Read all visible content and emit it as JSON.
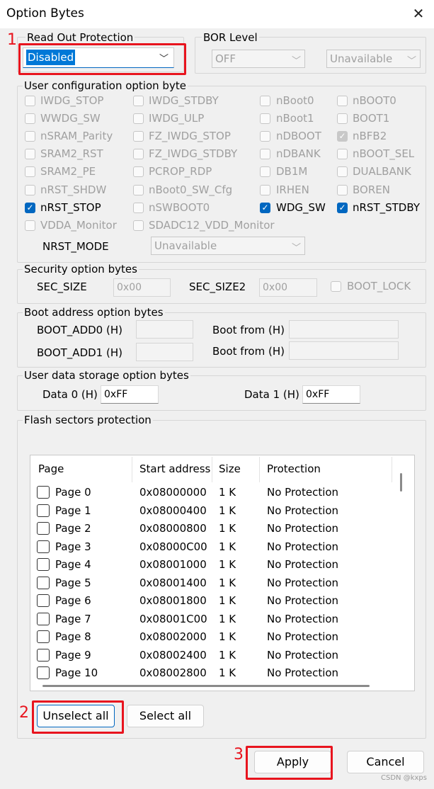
{
  "window": {
    "title": "Option Bytes",
    "close_glyph": "✕"
  },
  "rdp": {
    "legend": "Read Out Protection",
    "value": "Disabled",
    "annotation": "1"
  },
  "bor": {
    "legend": "BOR Level",
    "level_value": "OFF",
    "second_value": "Unavailable"
  },
  "user_config": {
    "legend": "User configuration option byte",
    "options": [
      {
        "label": "IWDG_STOP",
        "checked": false,
        "enabled": false
      },
      {
        "label": "IWDG_STDBY",
        "checked": false,
        "enabled": false
      },
      {
        "label": "nBoot0",
        "checked": false,
        "enabled": false
      },
      {
        "label": "nBOOT0",
        "checked": false,
        "enabled": false
      },
      {
        "label": "WWDG_SW",
        "checked": false,
        "enabled": false
      },
      {
        "label": "IWDG_ULP",
        "checked": false,
        "enabled": false
      },
      {
        "label": "nBoot1",
        "checked": false,
        "enabled": false
      },
      {
        "label": "BOOT1",
        "checked": false,
        "enabled": false
      },
      {
        "label": "nSRAM_Parity",
        "checked": false,
        "enabled": false
      },
      {
        "label": "FZ_IWDG_STOP",
        "checked": false,
        "enabled": false
      },
      {
        "label": "nDBOOT",
        "checked": false,
        "enabled": false
      },
      {
        "label": "nBFB2",
        "checked": true,
        "enabled": false
      },
      {
        "label": "SRAM2_RST",
        "checked": false,
        "enabled": false
      },
      {
        "label": "FZ_IWDG_STDBY",
        "checked": false,
        "enabled": false
      },
      {
        "label": "nDBANK",
        "checked": false,
        "enabled": false
      },
      {
        "label": "nBOOT_SEL",
        "checked": false,
        "enabled": false
      },
      {
        "label": "SRAM2_PE",
        "checked": false,
        "enabled": false
      },
      {
        "label": "PCROP_RDP",
        "checked": false,
        "enabled": false
      },
      {
        "label": "DB1M",
        "checked": false,
        "enabled": false
      },
      {
        "label": "DUALBANK",
        "checked": false,
        "enabled": false
      },
      {
        "label": "nRST_SHDW",
        "checked": false,
        "enabled": false
      },
      {
        "label": "nBoot0_SW_Cfg",
        "checked": false,
        "enabled": false
      },
      {
        "label": "IRHEN",
        "checked": false,
        "enabled": false
      },
      {
        "label": "BOREN",
        "checked": false,
        "enabled": false
      },
      {
        "label": "nRST_STOP",
        "checked": true,
        "enabled": true
      },
      {
        "label": "nSWBOOT0",
        "checked": false,
        "enabled": false
      },
      {
        "label": "WDG_SW",
        "checked": true,
        "enabled": true
      },
      {
        "label": "nRST_STDBY",
        "checked": true,
        "enabled": true
      },
      {
        "label": "VDDA_Monitor",
        "checked": false,
        "enabled": false
      },
      {
        "label": "SDADC12_VDD_Monitor",
        "checked": false,
        "enabled": false
      }
    ],
    "nrst_mode_label": "NRST_MODE",
    "nrst_mode_value": "Unavailable"
  },
  "security": {
    "legend": "Security option bytes",
    "sec_size_label": "SEC_SIZE",
    "sec_size_value": "0x00",
    "sec_size2_label": "SEC_SIZE2",
    "sec_size2_value": "0x00",
    "boot_lock_label": "BOOT_LOCK"
  },
  "boot_addr": {
    "legend": "Boot address option bytes",
    "add0_label": "BOOT_ADD0 (H)",
    "add1_label": "BOOT_ADD1 (H)",
    "from0_label": "Boot from (H)",
    "from1_label": "Boot from (H)"
  },
  "user_data": {
    "legend": "User data storage option bytes",
    "data0_label": "Data 0 (H)",
    "data0_value": "0xFF",
    "data1_label": "Data 1 (H)",
    "data1_value": "0xFF"
  },
  "flash": {
    "legend": "Flash sectors protection",
    "columns": [
      "Page",
      "Start address",
      "Size",
      "Protection"
    ],
    "rows": [
      [
        "Page 0",
        "0x08000000",
        "1 K",
        "No Protection"
      ],
      [
        "Page 1",
        "0x08000400",
        "1 K",
        "No Protection"
      ],
      [
        "Page 2",
        "0x08000800",
        "1 K",
        "No Protection"
      ],
      [
        "Page 3",
        "0x08000C00",
        "1 K",
        "No Protection"
      ],
      [
        "Page 4",
        "0x08001000",
        "1 K",
        "No Protection"
      ],
      [
        "Page 5",
        "0x08001400",
        "1 K",
        "No Protection"
      ],
      [
        "Page 6",
        "0x08001800",
        "1 K",
        "No Protection"
      ],
      [
        "Page 7",
        "0x08001C00",
        "1 K",
        "No Protection"
      ],
      [
        "Page 8",
        "0x08002000",
        "1 K",
        "No Protection"
      ],
      [
        "Page 9",
        "0x08002400",
        "1 K",
        "No Protection"
      ],
      [
        "Page 10",
        "0x08002800",
        "1 K",
        "No Protection"
      ]
    ],
    "unselect_all": "Unselect all",
    "select_all": "Select all",
    "annotation": "2"
  },
  "footer": {
    "apply": "Apply",
    "cancel": "Cancel",
    "annotation": "3",
    "watermark": "CSDN @kxps"
  }
}
